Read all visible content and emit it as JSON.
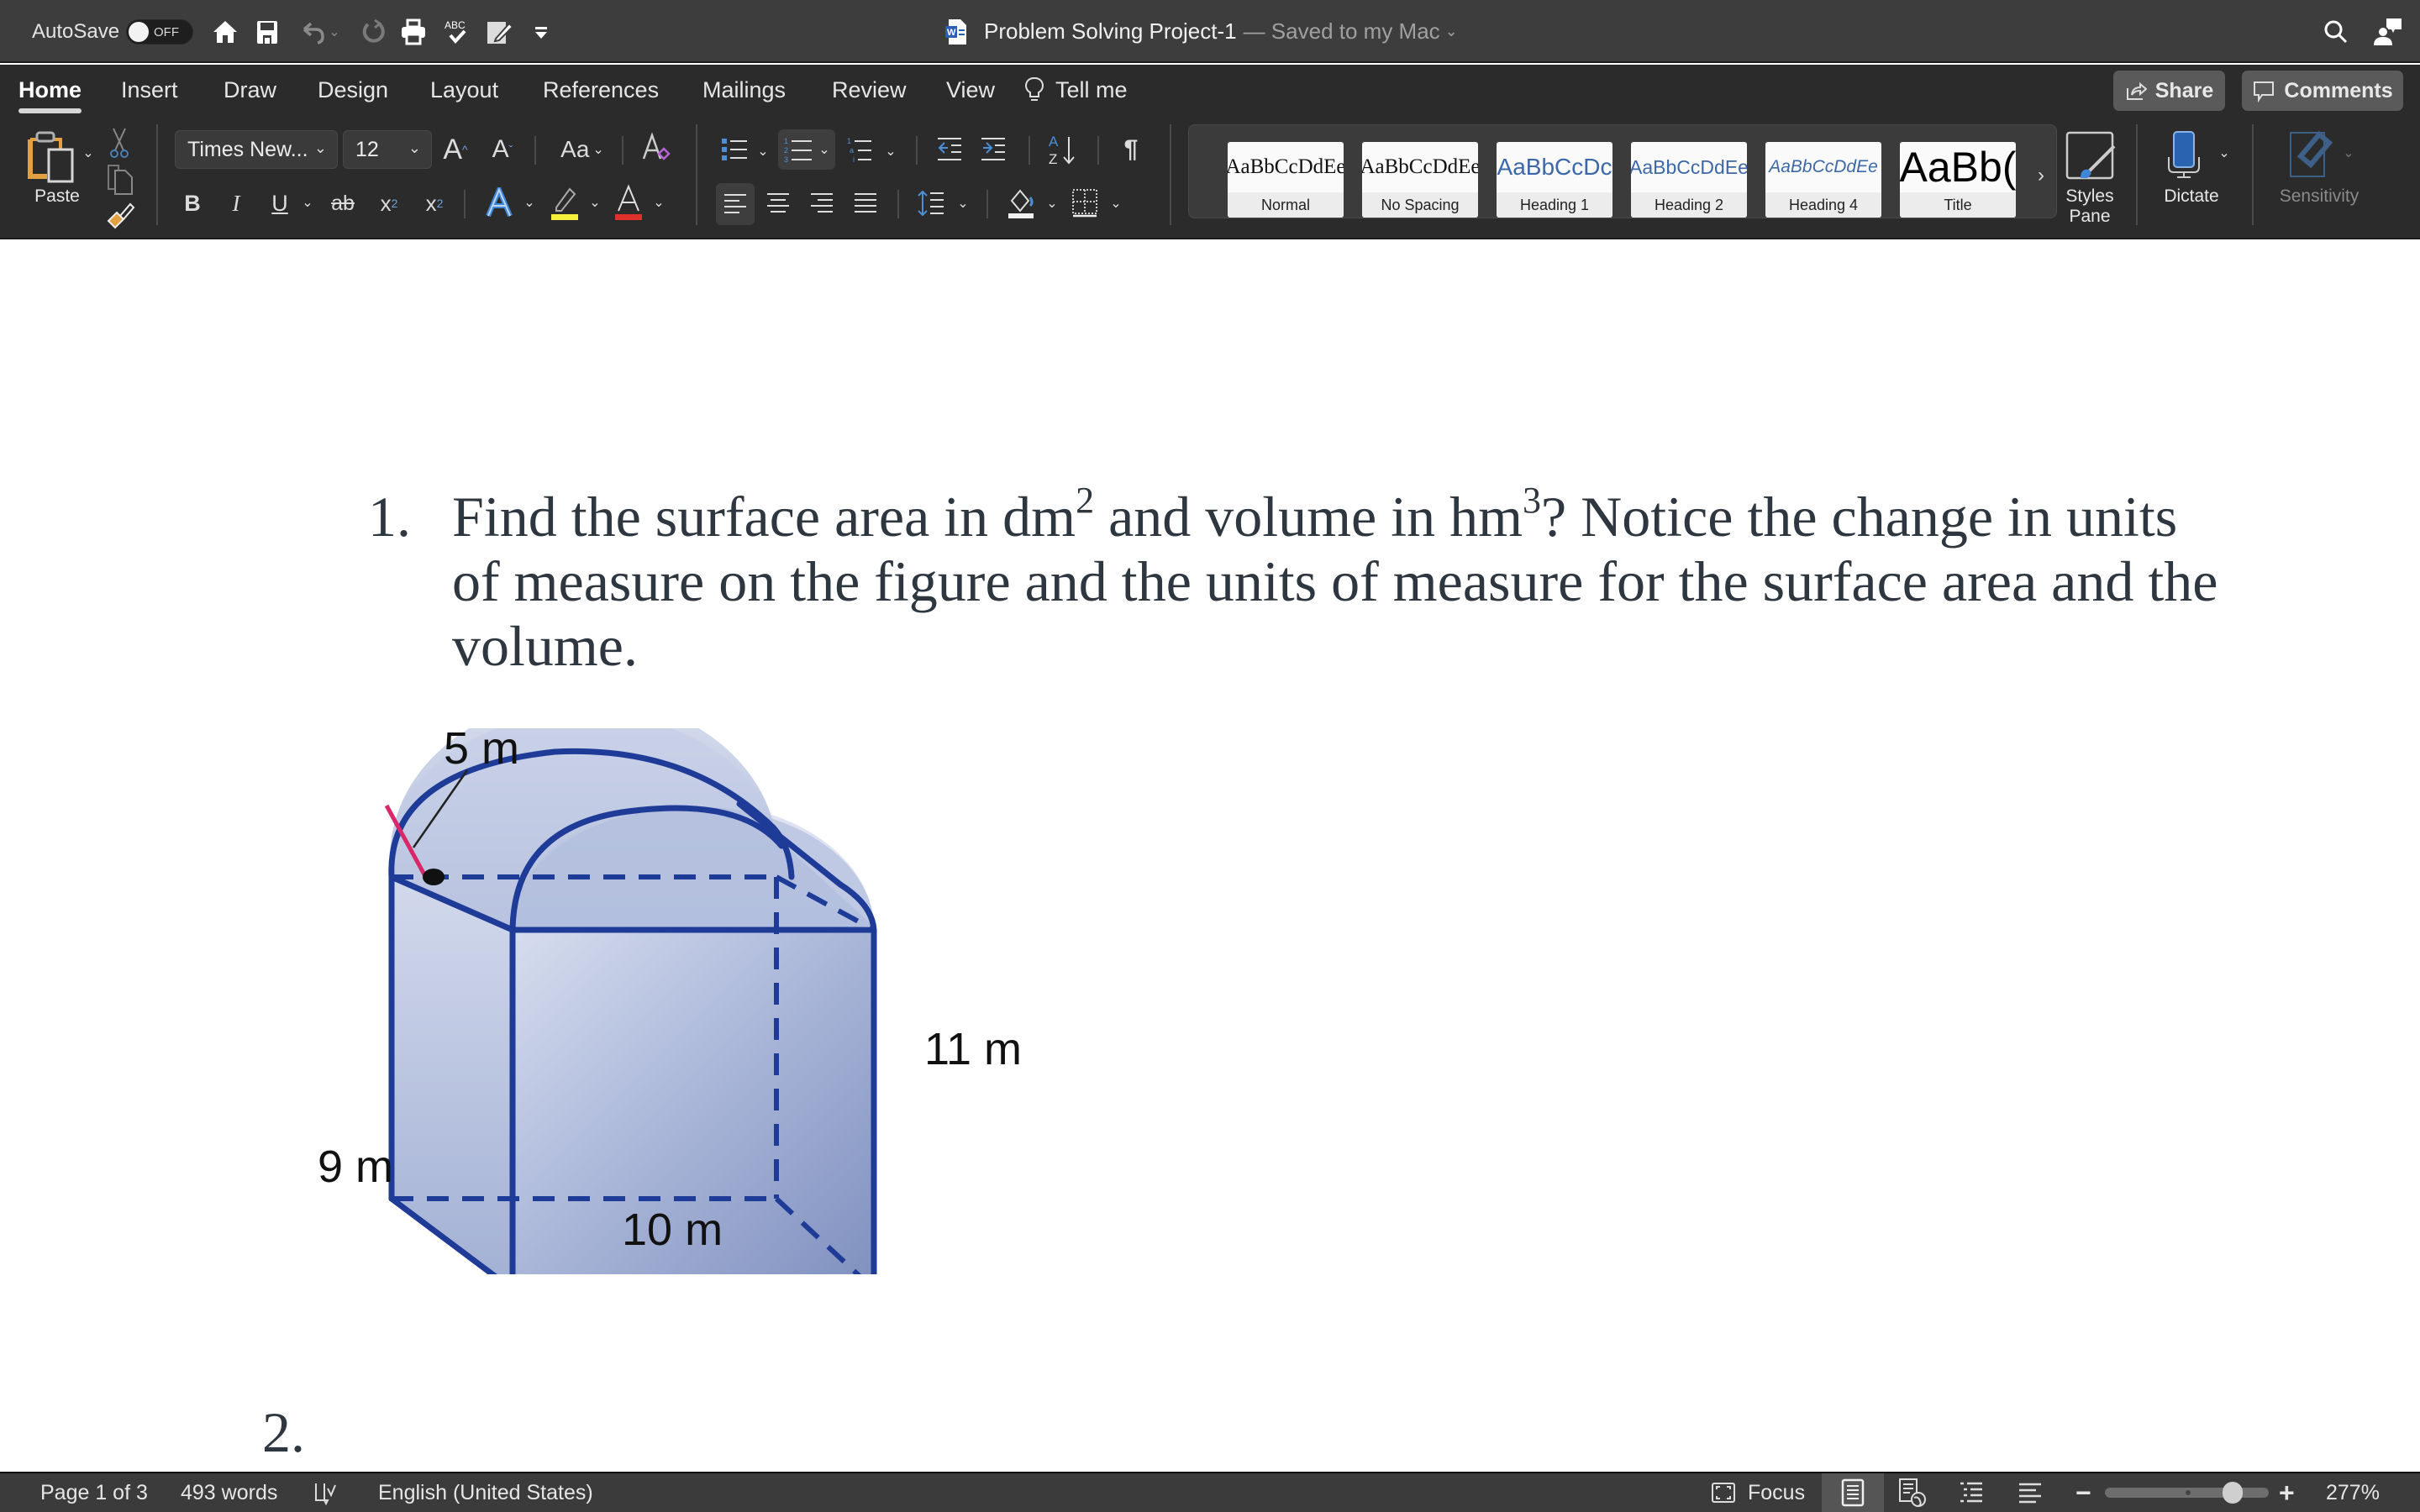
{
  "titlebar": {
    "autosave_label": "AutoSave",
    "autosave_state": "OFF",
    "quick_access": [
      "home-icon",
      "save-icon",
      "undo-icon",
      "redo-icon",
      "print-icon",
      "spelling-check-icon",
      "edit-document-icon",
      "customize-toolbar-icon"
    ],
    "doc_name": "Problem Solving Project-1",
    "save_status": "— Saved to my Mac",
    "right_icons": [
      "search-icon",
      "share-person-icon"
    ]
  },
  "tabs": [
    {
      "label": "Home",
      "active": true
    },
    {
      "label": "Insert"
    },
    {
      "label": "Draw"
    },
    {
      "label": "Design"
    },
    {
      "label": "Layout"
    },
    {
      "label": "References"
    },
    {
      "label": "Mailings"
    },
    {
      "label": "Review"
    },
    {
      "label": "View"
    },
    {
      "label": "Tell me"
    }
  ],
  "header_buttons": {
    "share": "Share",
    "comments": "Comments"
  },
  "ribbon": {
    "paste_label": "Paste",
    "font_name": "Times New...",
    "font_size": "12",
    "change_case": "Aa",
    "format_buttons": {
      "bold": "B",
      "italic": "I",
      "underline": "U",
      "strike": "ab",
      "subscript": "x",
      "superscript": "x"
    },
    "highlight_color": "#f5f03a",
    "font_color": "#e0302a",
    "styles": [
      {
        "sample": "AaBbCcDdEe",
        "label": "Normal"
      },
      {
        "sample": "AaBbCcDdEe",
        "label": "No Spacing"
      },
      {
        "sample": "AaBbCcDc",
        "label": "Heading 1"
      },
      {
        "sample": "AaBbCcDdEe",
        "label": "Heading 2"
      },
      {
        "sample": "AaBbCcDdEe",
        "label": "Heading 4"
      },
      {
        "sample": "AaBb(",
        "label": "Title"
      }
    ],
    "styles_pane_label": "Styles\nPane",
    "styles_pane_line1": "Styles",
    "styles_pane_line2": "Pane",
    "dictate_label": "Dictate",
    "sensitivity_label": "Sensitivity"
  },
  "document": {
    "q1_number": "1.",
    "q1_parts": {
      "a": "Find the surface area in dm",
      "sup1": "2",
      "b": " and volume in hm",
      "sup2": "3",
      "c": "?  Notice the change in units of measure on the figure and the units of measure for the surface area and the volume."
    },
    "figure": {
      "labels": {
        "radius": "5 m",
        "height": "11 m",
        "depth": "9 m",
        "width": "10 m"
      },
      "fill_color": "#a9b6d8",
      "edge_color": "#1e3a96",
      "radius_color": "#d8286a"
    },
    "q2_number": "2."
  },
  "statusbar": {
    "page": "Page 1 of 3",
    "words": "493 words",
    "language": "English (United States)",
    "focus": "Focus",
    "zoom_percent": "277%",
    "zoom_level": 277
  }
}
